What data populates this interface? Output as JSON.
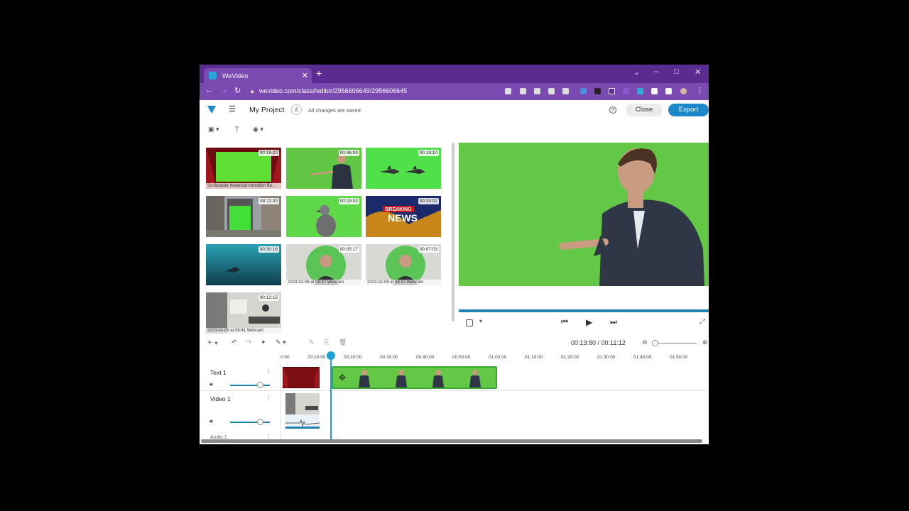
{
  "browser": {
    "tab_title": "WeVideo",
    "url": "wevideo.com/class#editor/2956606649/2956606645"
  },
  "app": {
    "project_title": "My Project",
    "save_status": "All changes are saved",
    "close_label": "Close",
    "export_label": "Export",
    "accent_color": "#1a88c9"
  },
  "library": {
    "items": [
      {
        "duration": "00:16:20",
        "caption": "Scribcaster theatrical transition Bo...",
        "kind": "curtain"
      },
      {
        "duration": "00:46:00",
        "caption": "",
        "kind": "presenter"
      },
      {
        "duration": "00:18:10",
        "caption": "",
        "kind": "sharks"
      },
      {
        "duration": "00:11:20",
        "caption": "",
        "kind": "billboard"
      },
      {
        "duration": "00:23:02",
        "caption": "",
        "kind": "pigeon"
      },
      {
        "duration": "00:10:02",
        "caption": "",
        "kind": "news",
        "overlay_top": "BREAKING",
        "overlay_bottom": "NEWS"
      },
      {
        "duration": "00:30:16",
        "caption": "",
        "kind": "underwater"
      },
      {
        "duration": "00:05:17",
        "caption": "2023-02-09 at 08:37 Webcam",
        "kind": "webcam"
      },
      {
        "duration": "00:07:03",
        "caption": "2023-02-09 at 08:37 Webcam",
        "kind": "webcam"
      },
      {
        "duration": "00:12:15",
        "caption": "2023-02-09 at 08:41 Webcam",
        "kind": "room"
      }
    ]
  },
  "player": {
    "time": "00:13:80 / 00:11:12",
    "progress": 1.0
  },
  "timeline": {
    "ruler_labels": [
      "0:00",
      "00:10:00",
      "00:20:00",
      "00:30:00",
      "00:40:00",
      "00:50:00",
      "01:00:00",
      "01:10:00",
      "01:20:00",
      "01:30:00",
      "01:40:00",
      "01:50:00"
    ],
    "tracks": [
      {
        "name": "Text 1",
        "volume": 0.75
      },
      {
        "name": "Video 1",
        "volume": 0.75
      },
      {
        "name": "Audio 1"
      }
    ]
  },
  "icons": [
    "image-icon",
    "text-icon",
    "color-icon",
    "add-icon",
    "undo-icon",
    "redo-icon",
    "magic-icon",
    "pencil-icon",
    "copy-icon",
    "trash-icon",
    "prev-icon",
    "play-icon",
    "next-icon",
    "fullscreen-icon",
    "zoom-out-icon",
    "zoom-in-icon",
    "move-icon",
    "speaker-icon"
  ]
}
